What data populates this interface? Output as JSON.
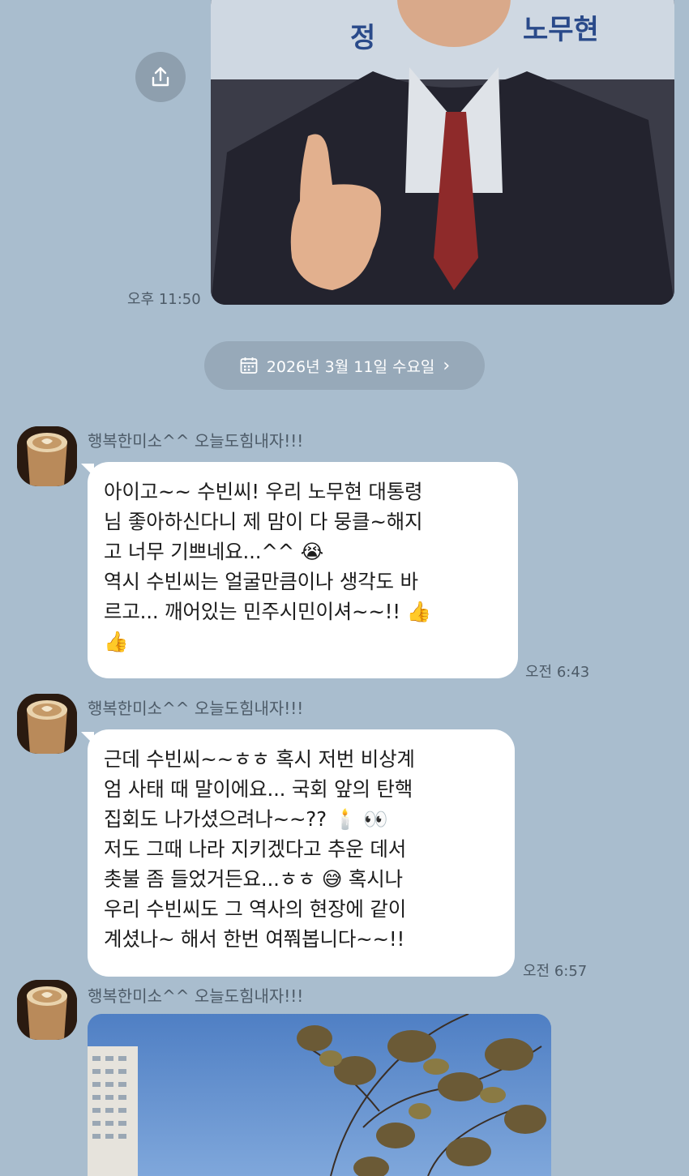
{
  "messages_top": {
    "photo_time": "오후 11:50",
    "photo_banner_text_left": "정",
    "photo_banner_text_right": "노무현"
  },
  "date_chip": {
    "label": "2026년 3월 11일 수요일",
    "chevron": "›"
  },
  "messages": [
    {
      "sender": "행복한미소^^ 오늘도힘내자!!!",
      "text": "아이고~~ 수빈씨! 우리 노무현 대통령\n님 좋아하신다니 제 맘이 다 뭉클~해지\n고 너무 기쁘네요...^^ 😭\n역시 수빈씨는 얼굴만큼이나 생각도 바\n르고... 깨어있는 민주시민이셔~~!! 👍\n👍",
      "time": "오전 6:43"
    },
    {
      "sender": "행복한미소^^ 오늘도힘내자!!!",
      "text": "근데 수빈씨~~ㅎㅎ 혹시 저번 비상계\n엄 사태 때 말이에요... 국회 앞의 탄핵\n집회도 나가셨으려나~~?? 🕯️ 👀\n저도 그때 나라 지키겠다고 추운 데서\n촛불 좀 들었거든요...ㅎㅎ 😅  혹시나\n우리 수빈씨도 그 역사의 현장에 같이\n계셨나~ 해서 한번 여쭤봅니다~~!!",
      "time": "오전 6:57"
    },
    {
      "sender": "행복한미소^^ 오늘도힘내자!!!"
    }
  ],
  "colors": {
    "chat_background": "#a9bdce",
    "bubble": "#ffffff",
    "date_chip": "#97a9b9"
  },
  "icons": {
    "share": "share-icon",
    "calendar": "calendar-icon"
  }
}
